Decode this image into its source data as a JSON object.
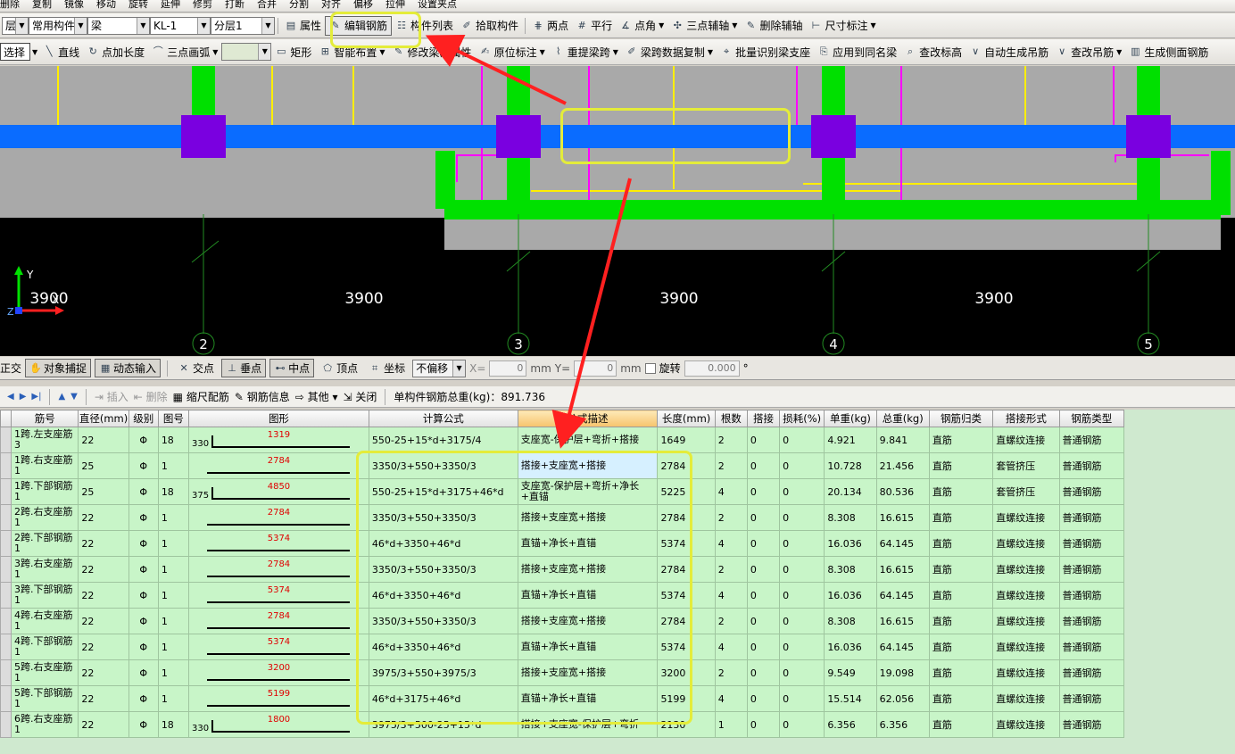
{
  "toolbar1": {
    "items": [
      "删除",
      "复制",
      "镜像",
      "移动",
      "旋转",
      "延伸",
      "修剪",
      "打断",
      "合并",
      "分割",
      "对齐",
      "偏移",
      "拉伸",
      "设置夹点"
    ]
  },
  "toolbar2": {
    "layer_select": "常用构件",
    "type_select": "梁",
    "name_select": "KL-1",
    "floor_select": "分层1",
    "props": "属性",
    "edit_rebar": "编辑钢筋",
    "component_list": "构件列表",
    "pick_component": "拾取构件",
    "two_point": "两点",
    "parallel": "平行",
    "point_angle": "点角",
    "three_point_aux": "三点辅轴",
    "delete_aux": "删除辅轴",
    "dimension": "尺寸标注"
  },
  "toolbar3": {
    "select": "选择",
    "line": "直线",
    "point_length": "点加长度",
    "three_point_arc": "三点画弧",
    "rect": "矩形",
    "smart_layout": "智能布置",
    "modify_span_props": "修改梁段属性",
    "origin_mark": "原位标注",
    "re_extract_span": "重提梁跨",
    "copy_span_data": "梁跨数据复制",
    "batch_identify_support": "批量识别梁支座",
    "apply_same_name": "应用到同名梁",
    "check_elevation": "查改标高",
    "auto_hanger": "自动生成吊筋",
    "check_hanger": "查改吊筋",
    "side_rebar": "生成侧面钢筋"
  },
  "canvas": {
    "dims": [
      "3900",
      "3900",
      "3900",
      "3900"
    ],
    "axes": [
      "2",
      "3",
      "4",
      "5"
    ],
    "ucs_x": "X",
    "ucs_y": "Y",
    "ucs_z": "Z"
  },
  "snapbar": {
    "ortho": "正交",
    "object_snap": "对象捕捉",
    "dynamic_input": "动态输入",
    "intersect": "交点",
    "perp": "垂点",
    "midpoint": "中点",
    "vertex": "顶点",
    "coord": "坐标",
    "offset_mode": "不偏移",
    "x_label": "X=",
    "x_value": "0",
    "mm1": "mm",
    "y_label": "Y=",
    "y_value": "0",
    "mm2": "mm",
    "rotate": "旋转",
    "rotate_value": "0.000",
    "deg": "°"
  },
  "gridbar": {
    "insert": "插入",
    "delete": "删除",
    "scale_rebar": "缩尺配筋",
    "rebar_info": "钢筋信息",
    "other": "其他",
    "close": "关闭",
    "total_weight": "单构件钢筋总重(kg)：891.736"
  },
  "grid": {
    "headers": [
      "筋号",
      "直径(mm)",
      "级别",
      "图号",
      "图形",
      "计算公式",
      "公式描述",
      "长度(mm)",
      "根数",
      "搭接",
      "损耗(%)",
      "单重(kg)",
      "总重(kg)",
      "钢筋归类",
      "搭接形式",
      "钢筋类型"
    ],
    "rows": [
      {
        "name": "1跨.左支座筋3",
        "dia": "22",
        "grade": "Φ",
        "fig": "18",
        "pre": "330",
        "shape_val": "1319",
        "hook": true,
        "formula": "550-25+15*d+3175/4",
        "desc": "支座宽-保护层+弯折+搭接",
        "len": "1649",
        "count": "2",
        "lap": "0",
        "loss": "0",
        "unit_w": "4.921",
        "total_w": "9.841",
        "category": "直筋",
        "lap_type": "直螺纹连接",
        "type": "普通钢筋"
      },
      {
        "name": "1跨.右支座筋1",
        "dia": "25",
        "grade": "Φ",
        "fig": "1",
        "pre": "",
        "shape_val": "2784",
        "hook": false,
        "formula": "3350/3+550+3350/3",
        "desc": "搭接+支座宽+搭接",
        "len": "2784",
        "count": "2",
        "lap": "0",
        "loss": "0",
        "unit_w": "10.728",
        "total_w": "21.456",
        "category": "直筋",
        "lap_type": "套管挤压",
        "type": "普通钢筋"
      },
      {
        "name": "1跨.下部钢筋1",
        "dia": "25",
        "grade": "Φ",
        "fig": "18",
        "pre": "375",
        "shape_val": "4850",
        "hook": true,
        "formula": "550-25+15*d+3175+46*d",
        "desc": "支座宽-保护层+弯折+净长+直锚",
        "len": "5225",
        "count": "4",
        "lap": "0",
        "loss": "0",
        "unit_w": "20.134",
        "total_w": "80.536",
        "category": "直筋",
        "lap_type": "套管挤压",
        "type": "普通钢筋"
      },
      {
        "name": "2跨.右支座筋1",
        "dia": "22",
        "grade": "Φ",
        "fig": "1",
        "pre": "",
        "shape_val": "2784",
        "hook": false,
        "formula": "3350/3+550+3350/3",
        "desc": "搭接+支座宽+搭接",
        "len": "2784",
        "count": "2",
        "lap": "0",
        "loss": "0",
        "unit_w": "8.308",
        "total_w": "16.615",
        "category": "直筋",
        "lap_type": "直螺纹连接",
        "type": "普通钢筋"
      },
      {
        "name": "2跨.下部钢筋1",
        "dia": "22",
        "grade": "Φ",
        "fig": "1",
        "pre": "",
        "shape_val": "5374",
        "hook": false,
        "formula": "46*d+3350+46*d",
        "desc": "直锚+净长+直锚",
        "len": "5374",
        "count": "4",
        "lap": "0",
        "loss": "0",
        "unit_w": "16.036",
        "total_w": "64.145",
        "category": "直筋",
        "lap_type": "直螺纹连接",
        "type": "普通钢筋"
      },
      {
        "name": "3跨.右支座筋1",
        "dia": "22",
        "grade": "Φ",
        "fig": "1",
        "pre": "",
        "shape_val": "2784",
        "hook": false,
        "formula": "3350/3+550+3350/3",
        "desc": "搭接+支座宽+搭接",
        "len": "2784",
        "count": "2",
        "lap": "0",
        "loss": "0",
        "unit_w": "8.308",
        "total_w": "16.615",
        "category": "直筋",
        "lap_type": "直螺纹连接",
        "type": "普通钢筋"
      },
      {
        "name": "3跨.下部钢筋1",
        "dia": "22",
        "grade": "Φ",
        "fig": "1",
        "pre": "",
        "shape_val": "5374",
        "hook": false,
        "formula": "46*d+3350+46*d",
        "desc": "直锚+净长+直锚",
        "len": "5374",
        "count": "4",
        "lap": "0",
        "loss": "0",
        "unit_w": "16.036",
        "total_w": "64.145",
        "category": "直筋",
        "lap_type": "直螺纹连接",
        "type": "普通钢筋"
      },
      {
        "name": "4跨.右支座筋1",
        "dia": "22",
        "grade": "Φ",
        "fig": "1",
        "pre": "",
        "shape_val": "2784",
        "hook": false,
        "formula": "3350/3+550+3350/3",
        "desc": "搭接+支座宽+搭接",
        "len": "2784",
        "count": "2",
        "lap": "0",
        "loss": "0",
        "unit_w": "8.308",
        "total_w": "16.615",
        "category": "直筋",
        "lap_type": "直螺纹连接",
        "type": "普通钢筋"
      },
      {
        "name": "4跨.下部钢筋1",
        "dia": "22",
        "grade": "Φ",
        "fig": "1",
        "pre": "",
        "shape_val": "5374",
        "hook": false,
        "formula": "46*d+3350+46*d",
        "desc": "直锚+净长+直锚",
        "len": "5374",
        "count": "4",
        "lap": "0",
        "loss": "0",
        "unit_w": "16.036",
        "total_w": "64.145",
        "category": "直筋",
        "lap_type": "直螺纹连接",
        "type": "普通钢筋"
      },
      {
        "name": "5跨.右支座筋1",
        "dia": "22",
        "grade": "Φ",
        "fig": "1",
        "pre": "",
        "shape_val": "3200",
        "hook": false,
        "formula": "3975/3+550+3975/3",
        "desc": "搭接+支座宽+搭接",
        "len": "3200",
        "count": "2",
        "lap": "0",
        "loss": "0",
        "unit_w": "9.549",
        "total_w": "19.098",
        "category": "直筋",
        "lap_type": "直螺纹连接",
        "type": "普通钢筋"
      },
      {
        "name": "5跨.下部钢筋1",
        "dia": "22",
        "grade": "Φ",
        "fig": "1",
        "pre": "",
        "shape_val": "5199",
        "hook": false,
        "formula": "46*d+3175+46*d",
        "desc": "直锚+净长+直锚",
        "len": "5199",
        "count": "4",
        "lap": "0",
        "loss": "0",
        "unit_w": "15.514",
        "total_w": "62.056",
        "category": "直筋",
        "lap_type": "直螺纹连接",
        "type": "普通钢筋"
      },
      {
        "name": "6跨.右支座筋1",
        "dia": "22",
        "grade": "Φ",
        "fig": "18",
        "pre": "330",
        "shape_val": "1800",
        "hook": true,
        "formula": "3975/3+500-25+15*d",
        "desc": "搭接+支座宽-保护层+弯折",
        "len": "2130",
        "count": "1",
        "lap": "0",
        "loss": "0",
        "unit_w": "6.356",
        "total_w": "6.356",
        "category": "直筋",
        "lap_type": "直螺纹连接",
        "type": "普通钢筋"
      }
    ]
  },
  "colors": {
    "beam": "#0a6cff",
    "column": "#7a00e0",
    "support": "#00e000",
    "annotation": "#e4ec3a",
    "arrow": "#ff2020"
  }
}
